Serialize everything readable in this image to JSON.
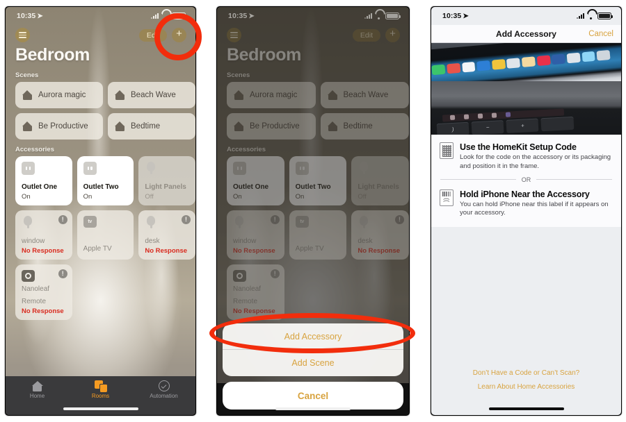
{
  "statusbar": {
    "time": "10:35",
    "location_icon": "location-arrow-icon"
  },
  "phone1": {
    "nav": {
      "menu_icon": "list-menu-icon",
      "edit_label": "Edit",
      "add_icon": "plus-icon"
    },
    "title": "Bedroom",
    "sections": {
      "scenes": "Scenes",
      "accessories": "Accessories"
    },
    "scenes": [
      {
        "label": "Aurora magic",
        "icon": "house-icon"
      },
      {
        "label": "Beach Wave",
        "icon": "house-icon"
      },
      {
        "label": "Be Productive",
        "icon": "house-icon"
      },
      {
        "label": "Bedtime",
        "icon": "house-icon"
      }
    ],
    "accessories": [
      {
        "name": "Outlet One",
        "status": "On",
        "state": "on",
        "icon": "outlet-icon"
      },
      {
        "name": "Outlet Two",
        "status": "On",
        "state": "on",
        "icon": "outlet-icon"
      },
      {
        "name": "Light Panels",
        "status": "Off",
        "state": "off",
        "icon": "bulb-icon"
      },
      {
        "name": "window",
        "status": "No Response",
        "state": "nores",
        "icon": "bulb-icon"
      },
      {
        "name": "Apple TV",
        "status": "",
        "state": "nores",
        "icon": "apple-tv-icon"
      },
      {
        "name": "desk",
        "status": "No Response",
        "state": "nores",
        "icon": "bulb-icon"
      },
      {
        "name": "Nanoleaf Remote",
        "status": "No Response",
        "state": "nores",
        "icon": "nanoleaf-icon"
      }
    ],
    "tabs": [
      {
        "label": "Home",
        "icon": "home-icon",
        "active": false
      },
      {
        "label": "Rooms",
        "icon": "rooms-icon",
        "active": true
      },
      {
        "label": "Automation",
        "icon": "automation-icon",
        "active": false
      }
    ]
  },
  "phone2": {
    "nav": {
      "menu_icon": "list-menu-icon",
      "edit_label": "Edit",
      "add_icon": "plus-icon"
    },
    "title": "Bedroom",
    "sections": {
      "scenes": "Scenes",
      "accessories": "Accessories"
    },
    "sheet": {
      "items": [
        "Add Accessory",
        "Add Scene"
      ],
      "cancel": "Cancel"
    }
  },
  "phone3": {
    "nav": {
      "title": "Add Accessory",
      "cancel": "Cancel"
    },
    "instructions": [
      {
        "icon": "qr-code-icon",
        "heading": "Use the HomeKit Setup Code",
        "body": "Look for the code on the accessory or its packaging and position it in the frame."
      },
      {
        "icon": "nfc-tag-icon",
        "heading": "Hold iPhone Near the Accessory",
        "body": "You can hold iPhone near this label if it appears on your accessory."
      }
    ],
    "divider_label": "OR",
    "links": [
      "Don’t Have a Code or Can’t Scan?",
      "Learn About Home Accessories"
    ]
  },
  "annotations": [
    {
      "name": "highlight-circle-add-button",
      "shape": "circle",
      "color": "#f22d0c"
    },
    {
      "name": "highlight-ellipse-add-accessory",
      "shape": "ellipse",
      "color": "#f22d0c"
    }
  ],
  "colors": {
    "accent_orange": "#f59b22",
    "sheet_gold": "#d8a33f",
    "error_red": "#d92b1f",
    "annotation_red": "#f22d0c"
  }
}
